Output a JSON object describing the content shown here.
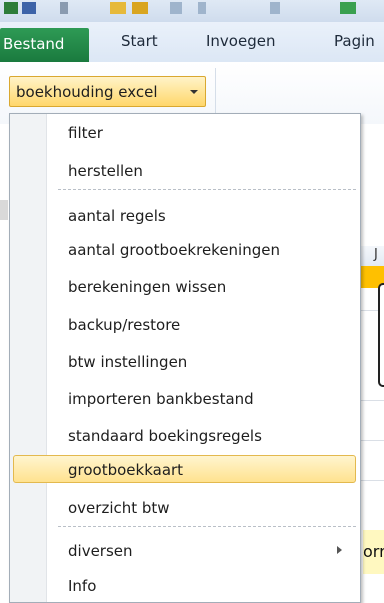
{
  "ribbon": {
    "tabs": [
      {
        "label": "Bestand"
      },
      {
        "label": "Start"
      },
      {
        "label": "Invoegen"
      },
      {
        "label": "Pagin"
      }
    ],
    "dropdown_label": "boekhouding excel"
  },
  "menu": {
    "items": [
      {
        "label": "filter"
      },
      {
        "label": "herstellen"
      },
      {
        "label": "aantal regels"
      },
      {
        "label": "aantal grootboekrekeningen"
      },
      {
        "label": "berekeningen wissen"
      },
      {
        "label": "backup/restore"
      },
      {
        "label": "btw instellingen"
      },
      {
        "label": "importeren bankbestand"
      },
      {
        "label": "standaard boekingsregels"
      },
      {
        "label": "grootboekkaart",
        "selected": true
      },
      {
        "label": "overzicht btw"
      },
      {
        "label": "diversen",
        "submenu": true
      },
      {
        "label": "Info"
      }
    ]
  },
  "sheet": {
    "column_letter": "J",
    "partial_cell_text": "orr"
  },
  "colors": {
    "file_tab": "#1f8a47",
    "highlight": "#ffe28f",
    "orange_row": "#ffc000"
  }
}
